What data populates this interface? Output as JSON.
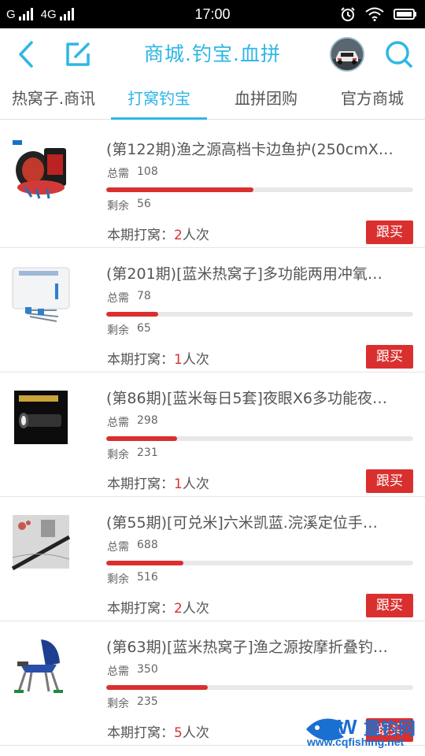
{
  "status_bar": {
    "carrier_left": "G",
    "network": "4G",
    "time": "17:00"
  },
  "header": {
    "title": "商城.钓宝.血拼"
  },
  "tabs": [
    {
      "label": "热窝子.商讯",
      "active": false
    },
    {
      "label": "打窝钓宝",
      "active": true
    },
    {
      "label": "血拼团购",
      "active": false
    },
    {
      "label": "官方商城",
      "active": false
    }
  ],
  "labels": {
    "need": "总需",
    "remain": "剩余",
    "count_prefix": "本期打窝：",
    "count_suffix": "人次",
    "buy": "跟买"
  },
  "items": [
    {
      "title": "(第122期)渔之源高档卡边鱼护(250cmX…",
      "total_need": "108",
      "remaining": "56",
      "count": "2",
      "progress": 0.48
    },
    {
      "title": "(第201期)[蓝米热窝子]多功能两用冲氧…",
      "total_need": "78",
      "remaining": "65",
      "count": "1",
      "progress": 0.17
    },
    {
      "title": "(第86期)[蓝米每日5套]夜眼X6多功能夜…",
      "total_need": "298",
      "remaining": "231",
      "count": "1",
      "progress": 0.23
    },
    {
      "title": "(第55期)[可兑米]六米凯蓝.浣溪定位手…",
      "total_need": "688",
      "remaining": "516",
      "count": "2",
      "progress": 0.25
    },
    {
      "title": "(第63期)[蓝米热窝子]渔之源按摩折叠钓…",
      "total_need": "350",
      "remaining": "235",
      "count": "5",
      "progress": 0.33
    }
  ],
  "watermark": {
    "url": "www.cqfishing.net",
    "brand": "重钓网"
  },
  "colors": {
    "accent": "#2eb6e6",
    "buy_red": "#d9302f"
  }
}
